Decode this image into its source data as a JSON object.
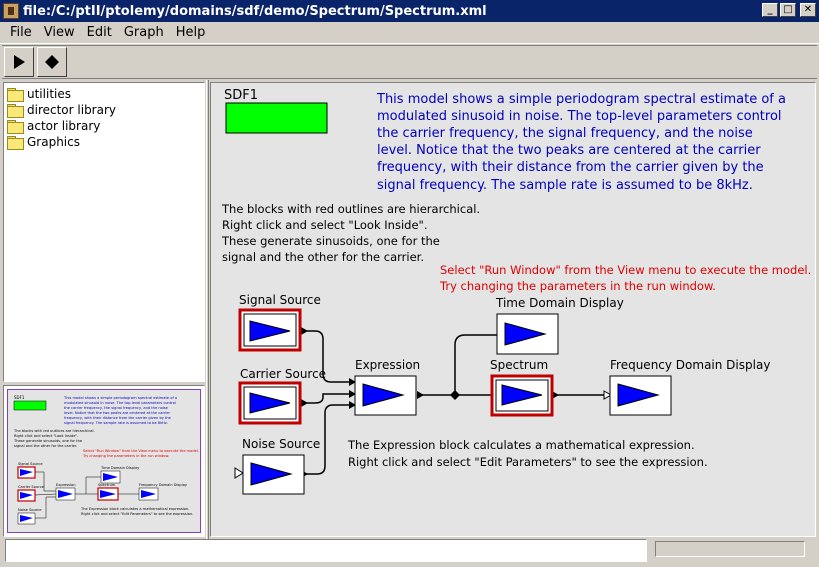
{
  "window": {
    "title": "file:/C:/ptII/ptolemy/domains/sdf/demo/Spectrum/Spectrum.xml"
  },
  "menu": [
    "File",
    "View",
    "Edit",
    "Graph",
    "Help"
  ],
  "toolbar": {
    "run_icon": "play-icon",
    "stop_icon": "stop-icon"
  },
  "library": {
    "items": [
      {
        "label": "utilities"
      },
      {
        "label": "director library"
      },
      {
        "label": "actor library"
      },
      {
        "label": "Graphics"
      }
    ]
  },
  "canvas": {
    "director_label": "SDF1",
    "description": [
      "This model shows a simple periodogram spectral estimate of a",
      "modulated sinusoid in noise. The top-level parameters control",
      "the carrier frequency, the signal frequency, and the noise",
      "level. Notice that the two peaks are centered at the carrier",
      "frequency, with their distance from the carrier given by the",
      "signal frequency. The sample rate is assumed to be 8kHz."
    ],
    "hierarchy_note": [
      "The blocks with red outlines are hierarchical.",
      "Right click and select \"Look Inside\".",
      "These generate sinusoids, one for the",
      "signal and the other for the carrier."
    ],
    "run_note": [
      "Select \"Run Window\" from the View menu to execute the model.",
      "Try changing the parameters in the run window."
    ],
    "expression_note": [
      "The Expression block calculates a mathematical expression.",
      "Right click and select \"Edit Parameters\" to see the expression."
    ],
    "actors": {
      "signal_source": "Signal Source",
      "carrier_source": "Carrier Source",
      "noise_source": "Noise Source",
      "expression": "Expression",
      "time_display": "Time Domain Display",
      "spectrum": "Spectrum",
      "freq_display": "Frequency Domain Display"
    }
  },
  "colors": {
    "director": "#00ff00",
    "description_text": "#0000c0",
    "note_text": "#e00000",
    "actor_triangle": "#0000ff",
    "hierarchical_outline": "#c00000"
  }
}
